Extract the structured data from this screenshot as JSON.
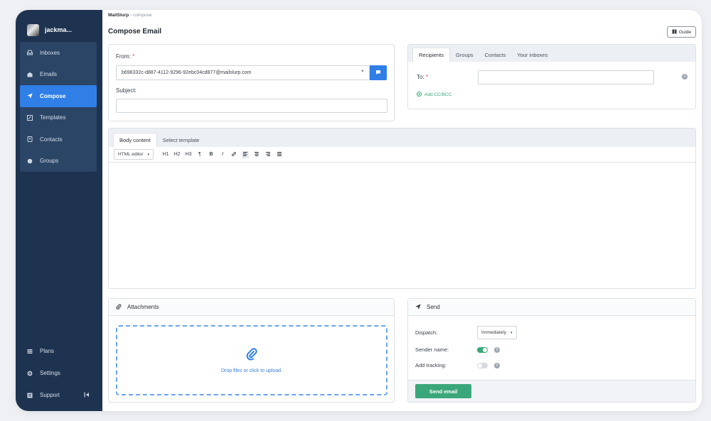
{
  "sidebar": {
    "user": "jackma...",
    "items": [
      {
        "label": "Inboxes",
        "icon": "inbox-icon"
      },
      {
        "label": "Emails",
        "icon": "mail-icon"
      },
      {
        "label": "Compose",
        "icon": "send-icon",
        "active": true
      },
      {
        "label": "Templates",
        "icon": "template-icon"
      },
      {
        "label": "Contacts",
        "icon": "contacts-icon"
      },
      {
        "label": "Groups",
        "icon": "groups-icon"
      }
    ],
    "bottom_items": [
      {
        "label": "Plans",
        "icon": "plans-icon"
      },
      {
        "label": "Settings",
        "icon": "gear-icon"
      },
      {
        "label": "Support",
        "icon": "support-icon"
      }
    ]
  },
  "header": {
    "breadcrumb_root": "MailSlurp",
    "breadcrumb_sep": "›",
    "breadcrumb_current": "compose",
    "title": "Compose Email",
    "guide_label": "Guide"
  },
  "from": {
    "label": "From:",
    "required": "*",
    "value": "b698332c-d887-4112-9296-92ebc04cd877@mailslurp.com"
  },
  "subject": {
    "label": "Subject:",
    "value": ""
  },
  "recipients": {
    "tabs": [
      "Recipients",
      "Groups",
      "Contacts",
      "Your inboxes"
    ],
    "to_label": "To:",
    "required": "*",
    "to_value": "",
    "add_cc_bcc": "Add CC/BCC"
  },
  "editor": {
    "tabs": [
      "Body content",
      "Select template"
    ],
    "mode": "HTML editor",
    "tools": [
      "H1",
      "H2",
      "H3",
      "¶",
      "B",
      "I",
      "🔗",
      "≡",
      "≡",
      "≡",
      "≡"
    ]
  },
  "attachments": {
    "title": "Attachments",
    "drop_text": "Drop files or click to upload."
  },
  "send": {
    "title": "Send",
    "dispatch_label": "Dispatch:",
    "dispatch_value": "Immediately",
    "sender_name_label": "Sender name:",
    "sender_name_on": true,
    "tracking_label": "Add tracking:",
    "tracking_on": false,
    "button_label": "Send email"
  },
  "colors": {
    "sidebar": "#1e3350",
    "accent": "#2f7fe6",
    "success": "#3aa77a"
  }
}
